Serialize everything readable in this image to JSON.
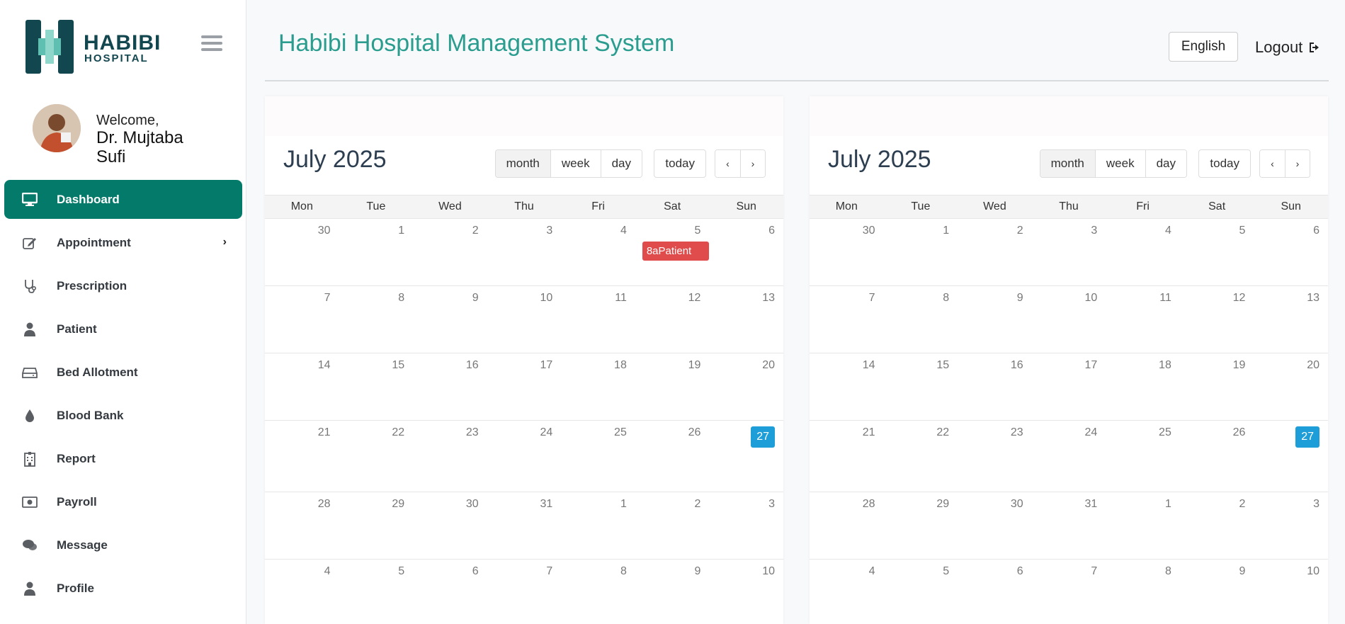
{
  "brand": {
    "name": "HABIBI",
    "sub": "HOSPITAL",
    "primary_color": "#047a6a",
    "accent_color": "#2a9d8f"
  },
  "sidebar": {
    "welcome": "Welcome,",
    "doctor_name": "Dr. Mujtaba Sufi",
    "items": [
      {
        "label": "Dashboard",
        "icon": "monitor-icon",
        "active": true
      },
      {
        "label": "Appointment",
        "icon": "edit-icon",
        "has_children": true
      },
      {
        "label": "Prescription",
        "icon": "stethoscope-icon"
      },
      {
        "label": "Patient",
        "icon": "user-icon"
      },
      {
        "label": "Bed Allotment",
        "icon": "bed-icon"
      },
      {
        "label": "Blood Bank",
        "icon": "blood-drop-icon"
      },
      {
        "label": "Report",
        "icon": "hospital-icon"
      },
      {
        "label": "Payroll",
        "icon": "money-icon"
      },
      {
        "label": "Message",
        "icon": "chat-icon"
      },
      {
        "label": "Profile",
        "icon": "user-icon"
      }
    ]
  },
  "header": {
    "title": "Habibi Hospital Management System",
    "language": "English",
    "logout": "Logout"
  },
  "calendar_common": {
    "weekdays": [
      "Mon",
      "Tue",
      "Wed",
      "Thu",
      "Fri",
      "Sat",
      "Sun"
    ],
    "views": [
      "month",
      "week",
      "day"
    ],
    "today_label": "today",
    "prev": "‹",
    "next": "›"
  },
  "calendars": [
    {
      "title": "July 2025",
      "weeks": [
        [
          "30",
          "1",
          "2",
          "3",
          "4",
          "5",
          "6"
        ],
        [
          "7",
          "8",
          "9",
          "10",
          "11",
          "12",
          "13"
        ],
        [
          "14",
          "15",
          "16",
          "17",
          "18",
          "19",
          "20"
        ],
        [
          "21",
          "22",
          "23",
          "24",
          "25",
          "26",
          "27"
        ],
        [
          "28",
          "29",
          "30",
          "31",
          "1",
          "2",
          "3"
        ],
        [
          "4",
          "5",
          "6",
          "7",
          "8",
          "9",
          "10"
        ]
      ],
      "today": "27",
      "events": [
        {
          "week": 0,
          "day": 5,
          "label": "8aPatient"
        }
      ]
    },
    {
      "title": "July 2025",
      "weeks": [
        [
          "30",
          "1",
          "2",
          "3",
          "4",
          "5",
          "6"
        ],
        [
          "7",
          "8",
          "9",
          "10",
          "11",
          "12",
          "13"
        ],
        [
          "14",
          "15",
          "16",
          "17",
          "18",
          "19",
          "20"
        ],
        [
          "21",
          "22",
          "23",
          "24",
          "25",
          "26",
          "27"
        ],
        [
          "28",
          "29",
          "30",
          "31",
          "1",
          "2",
          "3"
        ],
        [
          "4",
          "5",
          "6",
          "7",
          "8",
          "9",
          "10"
        ]
      ],
      "today": "27",
      "events": []
    }
  ]
}
